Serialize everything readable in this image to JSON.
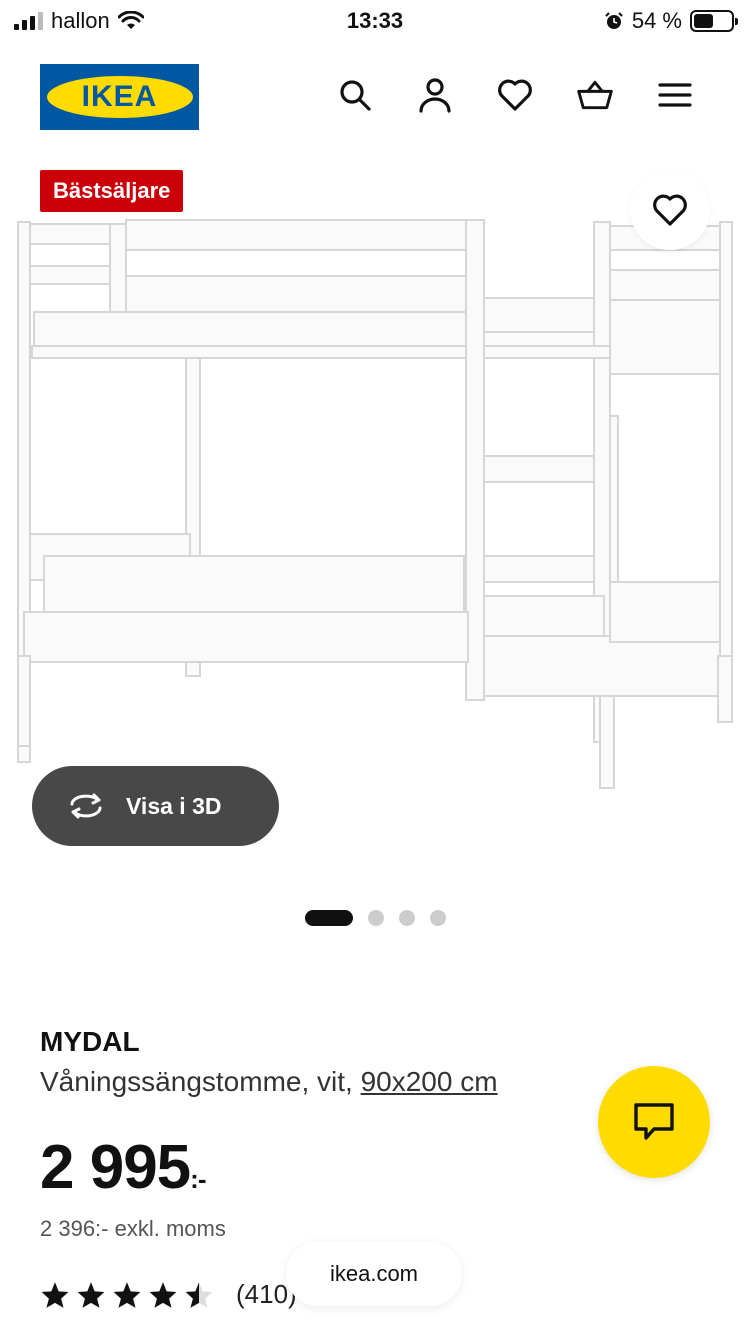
{
  "status_bar": {
    "carrier": "hallon",
    "time": "13:33",
    "battery_text": "54 %",
    "battery_level": 0.54
  },
  "header": {
    "logo_text": "IKEA",
    "icons": [
      "search-icon",
      "user-icon",
      "heart-icon",
      "basket-icon",
      "menu-icon"
    ]
  },
  "gallery": {
    "badge": "Bästsäljare",
    "view3d_label": "Visa i 3D",
    "image_count": 4,
    "active_index": 0
  },
  "product": {
    "name": "MYDAL",
    "description": "Våningssängstomme, vit,",
    "size": "90x200 cm",
    "price": "2 995",
    "price_suffix": ":-",
    "price_ex_vat": "2 396:- exkl. moms",
    "rating_value": 4.5,
    "rating_max": 5,
    "review_count": "(410)"
  },
  "browser": {
    "url": "ikea.com"
  },
  "colors": {
    "ikea_blue": "#0058a3",
    "ikea_yellow": "#ffdb00",
    "badge_red": "#cc0008",
    "pill_dark": "#484848"
  }
}
